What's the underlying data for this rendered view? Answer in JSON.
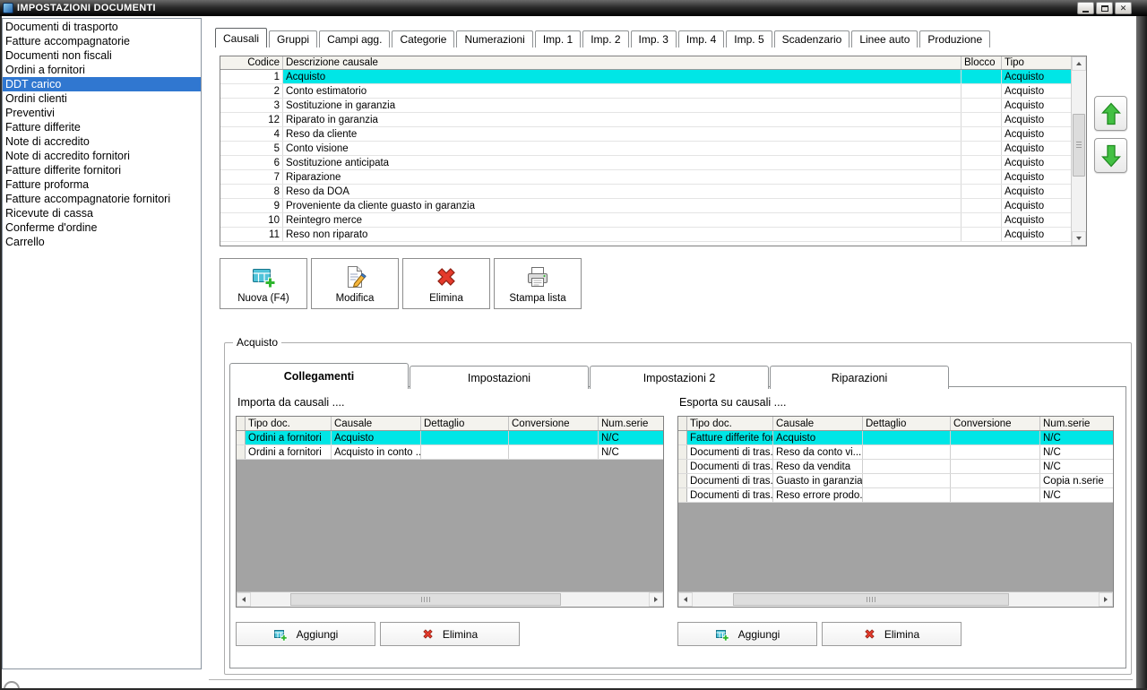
{
  "window": {
    "title": "IMPOSTAZIONI DOCUMENTI"
  },
  "icons": {
    "app-icon": "window",
    "minimize-icon": "_",
    "maximize-icon": "❐",
    "close-icon": "✕",
    "new-icon": "table-with-green-plus",
    "edit-icon": "document-with-pencil",
    "delete-icon": "red-x",
    "print-icon": "printer",
    "add-icon": "table-with-green-plus",
    "remove-icon": "red-x",
    "arrow-up-icon": "green-arrow-up",
    "arrow-down-icon": "green-arrow-down"
  },
  "colors": {
    "selection_cyan": "#00e6e6",
    "selection_blue": "#3077d0",
    "grid_filler": "#a3a3a3",
    "accent_green": "#3bbd3b",
    "delete_red": "#e43a2b"
  },
  "sidebar": {
    "items": [
      "Documenti di trasporto",
      "Fatture accompagnatorie",
      "Documenti non fiscali",
      "Ordini a fornitori",
      "DDT carico",
      "Ordini clienti",
      "Preventivi",
      "Fatture differite",
      "Note di accredito",
      "Note di accredito fornitori",
      "Fatture differite fornitori",
      "Fatture proforma",
      "Fatture accompagnatorie fornitori",
      "Ricevute di cassa",
      "Conferme d'ordine",
      "Carrello"
    ],
    "selected_index": 4
  },
  "tabs": {
    "items": [
      "Causali",
      "Gruppi",
      "Campi agg.",
      "Categorie",
      "Numerazioni",
      "Imp. 1",
      "Imp. 2",
      "Imp. 3",
      "Imp. 4",
      "Imp. 5",
      "Scadenzario",
      "Linee auto",
      "Produzione"
    ],
    "selected_index": 0
  },
  "causali_table": {
    "columns": [
      "Codice",
      "Descrizione causale",
      "Blocco",
      "Tipo"
    ],
    "rows": [
      [
        "1",
        "Acquisto",
        "",
        "Acquisto"
      ],
      [
        "2",
        "Conto estimatorio",
        "",
        "Acquisto"
      ],
      [
        "3",
        "Sostituzione in garanzia",
        "",
        "Acquisto"
      ],
      [
        "12",
        "Riparato in garanzia",
        "",
        "Acquisto"
      ],
      [
        "4",
        "Reso da cliente",
        "",
        "Acquisto"
      ],
      [
        "5",
        "Conto visione",
        "",
        "Acquisto"
      ],
      [
        "6",
        "Sostituzione anticipata",
        "",
        "Acquisto"
      ],
      [
        "7",
        "Riparazione",
        "",
        "Acquisto"
      ],
      [
        "8",
        "Reso da DOA",
        "",
        "Acquisto"
      ],
      [
        "9",
        "Proveniente da cliente guasto in garanzia",
        "",
        "Acquisto"
      ],
      [
        "10",
        "Reintegro merce",
        "",
        "Acquisto"
      ],
      [
        "11",
        "Reso non riparato",
        "",
        "Acquisto"
      ]
    ],
    "selected_index": 0
  },
  "toolbar": {
    "new_label": "Nuova (F4)",
    "edit_label": "Modifica",
    "delete_label": "Elimina",
    "print_label": "Stampa lista"
  },
  "detail": {
    "group_title": "Acquisto",
    "tabs": [
      "Collegamenti",
      "Impostazioni",
      "Impostazioni 2",
      "Riparazioni"
    ],
    "selected_tab_index": 0,
    "import_panel": {
      "title": "Importa da causali ....",
      "columns": [
        "Tipo doc.",
        "Causale",
        "Dettaglio",
        "Conversione",
        "Num.serie"
      ],
      "rows": [
        [
          "Ordini a fornitori",
          "Acquisto",
          "",
          "",
          "N/C"
        ],
        [
          "Ordini a fornitori",
          "Acquisto in conto ...",
          "",
          "",
          "N/C"
        ]
      ],
      "selected_index": 0,
      "add_label": "Aggiungi",
      "delete_label": "Elimina"
    },
    "export_panel": {
      "title": "Esporta su causali ....",
      "columns": [
        "Tipo doc.",
        "Causale",
        "Dettaglio",
        "Conversione",
        "Num.serie"
      ],
      "rows": [
        [
          "Fatture differite for...",
          "Acquisto",
          "",
          "",
          "N/C"
        ],
        [
          "Documenti di tras...",
          "Reso da conto vi...",
          "",
          "",
          "N/C"
        ],
        [
          "Documenti di tras...",
          "Reso da vendita",
          "",
          "",
          "N/C"
        ],
        [
          "Documenti di tras...",
          "Guasto in garanzia",
          "",
          "",
          "Copia n.serie"
        ],
        [
          "Documenti di tras...",
          "Reso errore prodo...",
          "",
          "",
          "N/C"
        ]
      ],
      "selected_index": 0,
      "add_label": "Aggiungi",
      "delete_label": "Elimina"
    }
  }
}
